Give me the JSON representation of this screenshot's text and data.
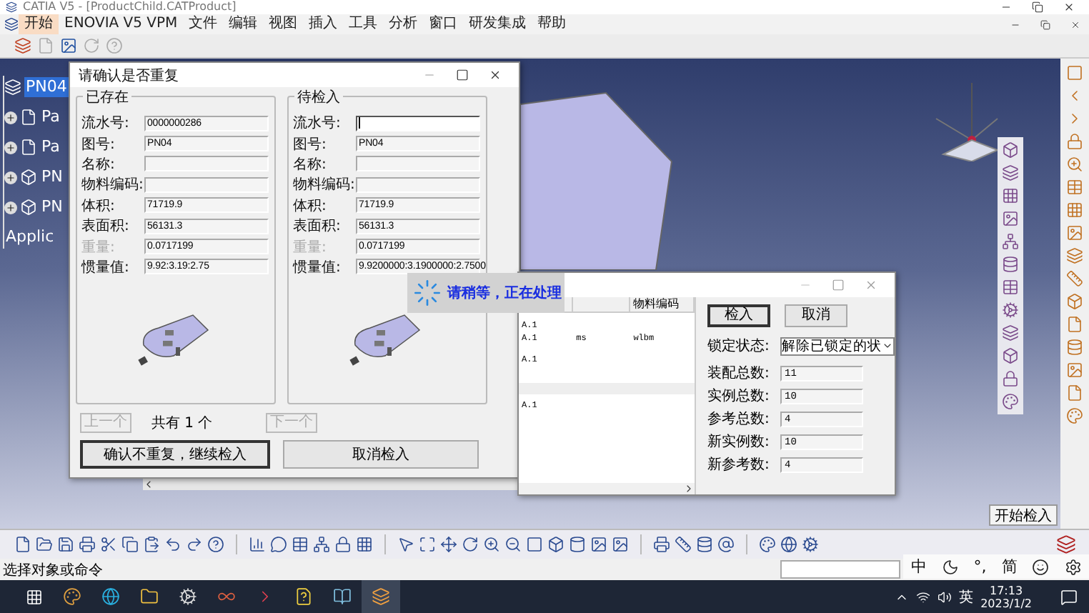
{
  "window": {
    "title": "CATIA V5 - [ProductChild.CATProduct]"
  },
  "menu": [
    {
      "label": "开始",
      "selected": true
    },
    {
      "label": "ENOVIA V5 VPM",
      "selected": false
    },
    {
      "label": "文件",
      "selected": false
    },
    {
      "label": "编辑",
      "selected": false
    },
    {
      "label": "视图",
      "selected": false
    },
    {
      "label": "插入",
      "selected": false
    },
    {
      "label": "工具",
      "selected": false
    },
    {
      "label": "分析",
      "selected": false
    },
    {
      "label": "窗口",
      "selected": false
    },
    {
      "label": "研发集成",
      "selected": false
    },
    {
      "label": "帮助",
      "selected": false
    }
  ],
  "tree": {
    "items": [
      {
        "kind": "root",
        "label": "PN04",
        "selected": true
      },
      {
        "kind": "drawing",
        "label": "Pa",
        "selected": false
      },
      {
        "kind": "drawing",
        "label": "Pa",
        "selected": false
      },
      {
        "kind": "part",
        "label": "PN",
        "selected": false
      },
      {
        "kind": "part",
        "label": "PN",
        "selected": false
      },
      {
        "kind": "app",
        "label": "Applic",
        "selected": false
      }
    ]
  },
  "confirm_dialog": {
    "title": "请确认是否重复",
    "groups": [
      {
        "title": "已存在",
        "fields": [
          {
            "label": "流水号:",
            "value": "0000000286",
            "disabled": false,
            "focused": false
          },
          {
            "label": "图号:",
            "value": "PN04",
            "disabled": false,
            "focused": false
          },
          {
            "label": "名称:",
            "disabled": false,
            "focused": false
          },
          {
            "label": "物料编码:",
            "disabled": false,
            "focused": false
          },
          {
            "label": "体积:",
            "value": "71719.9",
            "disabled": false,
            "focused": false
          },
          {
            "label": "表面积:",
            "value": "56131.3",
            "disabled": false,
            "focused": false
          },
          {
            "label": "重量:",
            "value": "0.0717199",
            "disabled": true,
            "focused": false
          },
          {
            "label": "惯量值:",
            "value": "9.92:3.19:2.75",
            "disabled": false,
            "focused": false
          }
        ]
      },
      {
        "title": "待检入",
        "fields": [
          {
            "label": "流水号:",
            "disabled": false,
            "focused": true
          },
          {
            "label": "图号:",
            "value": "PN04",
            "disabled": false,
            "focused": false
          },
          {
            "label": "名称:",
            "disabled": false,
            "focused": false
          },
          {
            "label": "物料编码:",
            "disabled": false,
            "focused": false
          },
          {
            "label": "体积:",
            "value": "71719.9",
            "disabled": false,
            "focused": false
          },
          {
            "label": "表面积:",
            "value": "56131.3",
            "disabled": false,
            "focused": false
          },
          {
            "label": "重量:",
            "value": "0.0717199",
            "disabled": true,
            "focused": false
          },
          {
            "label": "惯量值:",
            "value": "9.9200000:3.1900000:2.7500",
            "disabled": false,
            "focused": false
          }
        ]
      }
    ],
    "pager": {
      "prev": {
        "label": "上一个",
        "disabled": true
      },
      "count": "共有 1 个",
      "next": {
        "label": "下一个",
        "disabled": true
      }
    },
    "buttons": [
      {
        "label": "确认不重复，继续检入",
        "default": true
      },
      {
        "label": "取消检入",
        "default": false
      }
    ]
  },
  "busy": {
    "message": "请稍等，正在处理"
  },
  "checkin_dialog": {
    "table": {
      "column_3": "物料编码",
      "rows": [
        {
          "cells": [
            "A.1"
          ]
        },
        {
          "cells": [
            "A.1",
            "ms",
            "wlbm"
          ]
        },
        {
          "cells": [
            "A.1"
          ]
        }
      ],
      "lower_rows": [
        {
          "cells": [
            "A.1"
          ]
        }
      ]
    },
    "buttons": [
      {
        "label": "检入",
        "default": true
      },
      {
        "label": "取消",
        "default": false
      }
    ],
    "lock": {
      "label": "锁定状态:",
      "value": "解除已锁定的状"
    },
    "counts": [
      {
        "label": "装配总数:",
        "value": "11"
      },
      {
        "label": "实例总数:",
        "value": "10"
      },
      {
        "label": "参考总数:",
        "value": "4"
      },
      {
        "label": "新实例数:",
        "value": "10"
      },
      {
        "label": "新参考数:",
        "value": "4"
      }
    ]
  },
  "start_checkin": {
    "label": "开始检入"
  },
  "status_bar": {
    "prompt": "选择对象或命令"
  },
  "ime": [
    {
      "kind": "text",
      "label": "中"
    },
    {
      "kind": "moon"
    },
    {
      "kind": "text",
      "label": "°,"
    },
    {
      "kind": "text",
      "label": "简"
    },
    {
      "kind": "smile"
    },
    {
      "kind": "gear"
    }
  ],
  "taskbar": {
    "language": "英",
    "time": "17:13",
    "date": "2023/1/2"
  }
}
